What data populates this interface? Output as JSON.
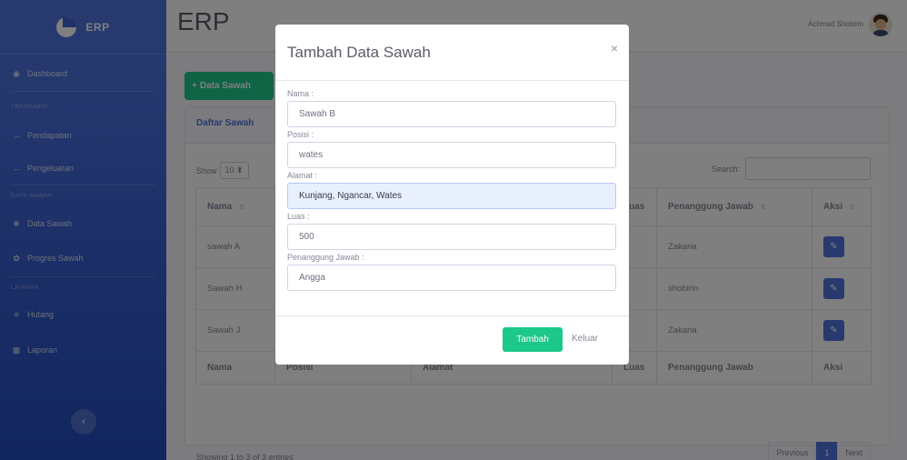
{
  "app": {
    "brand": "ERP",
    "page_title": "ERP",
    "user_name": "Achmad Shobirin"
  },
  "sidebar": {
    "dashboard": "Dashboard",
    "sections": [
      {
        "heading": "TRANSAKSI",
        "items": [
          "Pendapatan",
          "Pengeluaran"
        ]
      },
      {
        "heading": "DATA SAWAH",
        "items": [
          "Data Sawah",
          "Progres Sawah"
        ]
      },
      {
        "heading": "LAINNYA",
        "items": [
          "Hutang",
          "Laporan"
        ]
      }
    ]
  },
  "content": {
    "add_button": "Data Sawah",
    "card_title": "Daftar Sawah",
    "show_label": "Show",
    "show_value": "10",
    "search_label": "Search:",
    "columns": [
      "Nama",
      "Posisi",
      "Alamat",
      "Luas",
      "Penanggung Jawab",
      "Aksi"
    ],
    "rows": [
      {
        "nama": "sawah A",
        "posisi": "",
        "alamat": "",
        "luas": "",
        "pj": "Zakaria"
      },
      {
        "nama": "Sawah H",
        "posisi": "",
        "alamat": "",
        "luas": "",
        "pj": "shobirin"
      },
      {
        "nama": "Sawah J",
        "posisi": "",
        "alamat": "",
        "luas": "",
        "pj": "Zakaria"
      }
    ],
    "info": "Showing 1 to 3 of 3 entries",
    "pager": {
      "previous": "Previous",
      "current": "1",
      "next": "Next"
    }
  },
  "modal": {
    "title": "Tambah Data Sawah",
    "close": "×",
    "fields": [
      {
        "label": "Nama :",
        "value": "Sawah B"
      },
      {
        "label": "Posisi :",
        "value": "wates"
      },
      {
        "label": "Alamat :",
        "value": "Kunjang, Ngancar, Wates"
      },
      {
        "label": "Luas :",
        "value": "500"
      },
      {
        "label": "Penanggung Jawab :",
        "value": "Angga"
      }
    ],
    "submit": "Tambah",
    "cancel": "Keluar"
  }
}
